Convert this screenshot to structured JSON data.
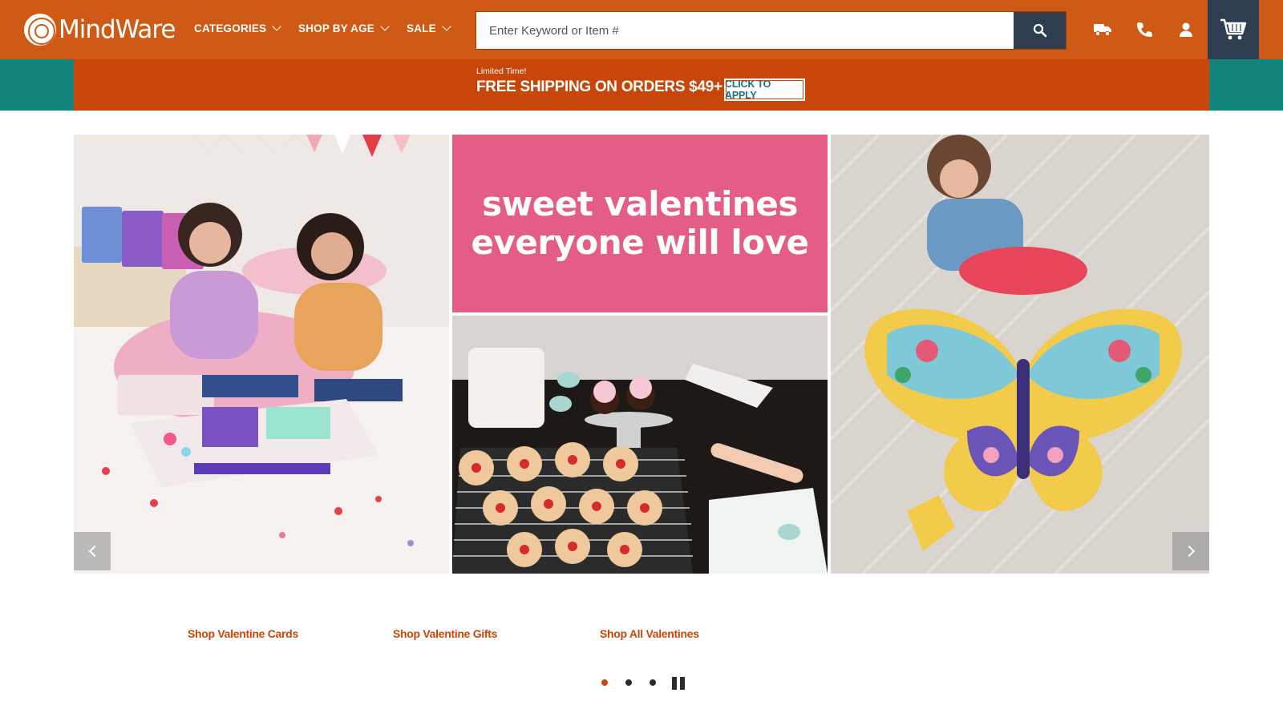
{
  "brand": {
    "name": "MindWare"
  },
  "nav": {
    "items": [
      {
        "label": "CATEGORIES"
      },
      {
        "label": "SHOP BY AGE"
      },
      {
        "label": "SALE"
      }
    ]
  },
  "search": {
    "placeholder": "Enter Keyword or Item #",
    "value": ""
  },
  "promo": {
    "eyebrow": "Limited Time!",
    "headline": "FREE SHIPPING ON ORDERS $49+",
    "button_label": "CLICK TO APPLY"
  },
  "hero": {
    "banner_line1": "sweet valentines",
    "banner_line2": "everyone will love",
    "links": [
      {
        "label": "Shop Valentine Cards"
      },
      {
        "label": "Shop Valentine Gifts"
      },
      {
        "label": "Shop All Valentines"
      }
    ],
    "slide_count": 3,
    "active_slide": 1
  },
  "colors": {
    "header": "#cf5a16",
    "promo": "#c84609",
    "teal": "#128479",
    "navy": "#2f3d51",
    "link": "#c84609",
    "banner_pink": "#e35d84"
  },
  "icons": {
    "shipping": "truck-icon",
    "phone": "phone-icon",
    "account": "user-icon",
    "cart": "cart-icon",
    "search": "search-icon"
  }
}
